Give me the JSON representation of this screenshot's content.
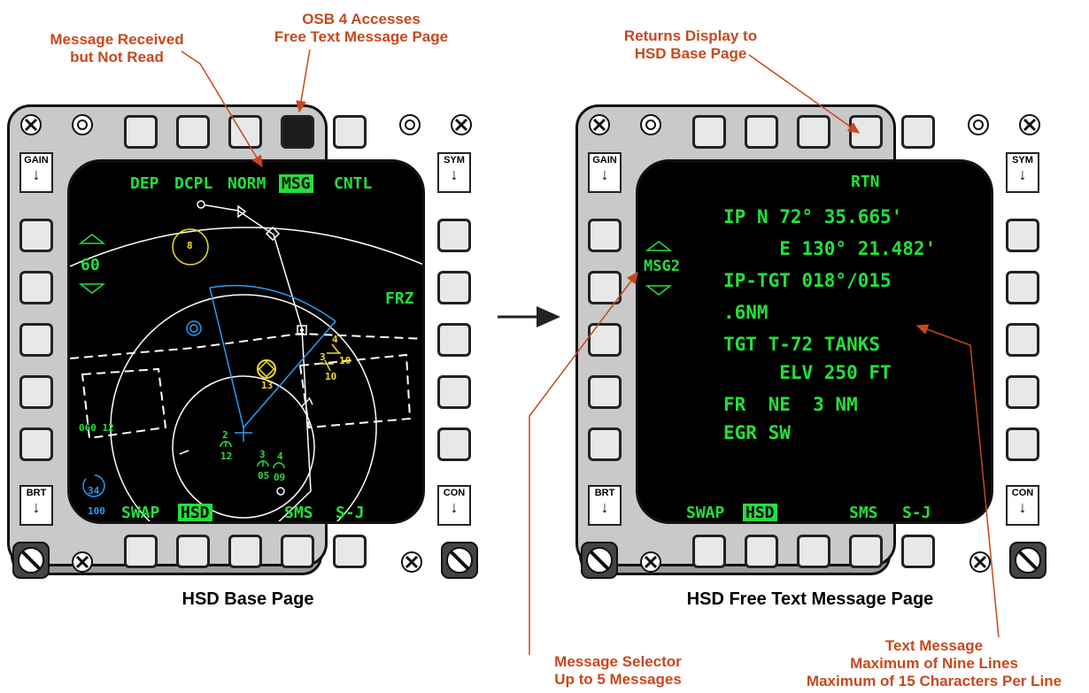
{
  "callouts": {
    "msg_received": [
      "Message Received",
      "but Not Read"
    ],
    "osb4": [
      "OSB 4 Accesses",
      "Free Text Message Page"
    ],
    "returns": [
      "Returns Display to",
      "HSD Base Page"
    ],
    "msg_selector": [
      "Message Selector",
      "Up to 5 Messages"
    ],
    "text_message": [
      "Text Message",
      "Maximum of Nine Lines",
      "Maximum of 15 Characters Per Line"
    ]
  },
  "captions": {
    "left": "HSD Base Page",
    "right": "HSD Free Text Message Page"
  },
  "rockers": {
    "gain": "GAIN",
    "sym": "SYM",
    "brt": "BRT",
    "con": "CON"
  },
  "base_page": {
    "top_labels": {
      "dep": "DEP",
      "dcpl": "DCPL",
      "norm": "NORM",
      "msg": "MSG",
      "cntl": "CNTL"
    },
    "bottom_labels": {
      "swap": "SWAP",
      "hsd": "HSD",
      "sms": "SMS",
      "sj": "S-J"
    },
    "range": "60",
    "frz": "FRZ",
    "threat_8": "8",
    "target_13": "13",
    "wp_labels": {
      "a": "4",
      "b": "3",
      "c": "10",
      "d": "10"
    },
    "friendly_labels": {
      "f1": "2",
      "f2": "12",
      "f3": "3",
      "f4": "05",
      "f5": "4",
      "f6": "09"
    },
    "heading_readout": "060 12",
    "circle_34": "34",
    "num_100": "100"
  },
  "msg_page": {
    "rtn": "RTN",
    "msg_selector": "MSG2",
    "lines": [
      "IP N 72° 35.665'",
      "     E 130° 21.482'",
      "IP-TGT 018°/015",
      ".6NM",
      "TGT T-72 TANKS",
      "     ELV 250 FT",
      "FR  NE  3 NM",
      "EGR SW"
    ],
    "bottom_labels": {
      "swap": "SWAP",
      "hsd": "HSD",
      "sms": "SMS",
      "sj": "S-J"
    }
  },
  "colors": {
    "callout": "#c8481c",
    "mfd_green": "#22e03a",
    "yellow": "#f0e020",
    "blue": "#2a9df4"
  }
}
